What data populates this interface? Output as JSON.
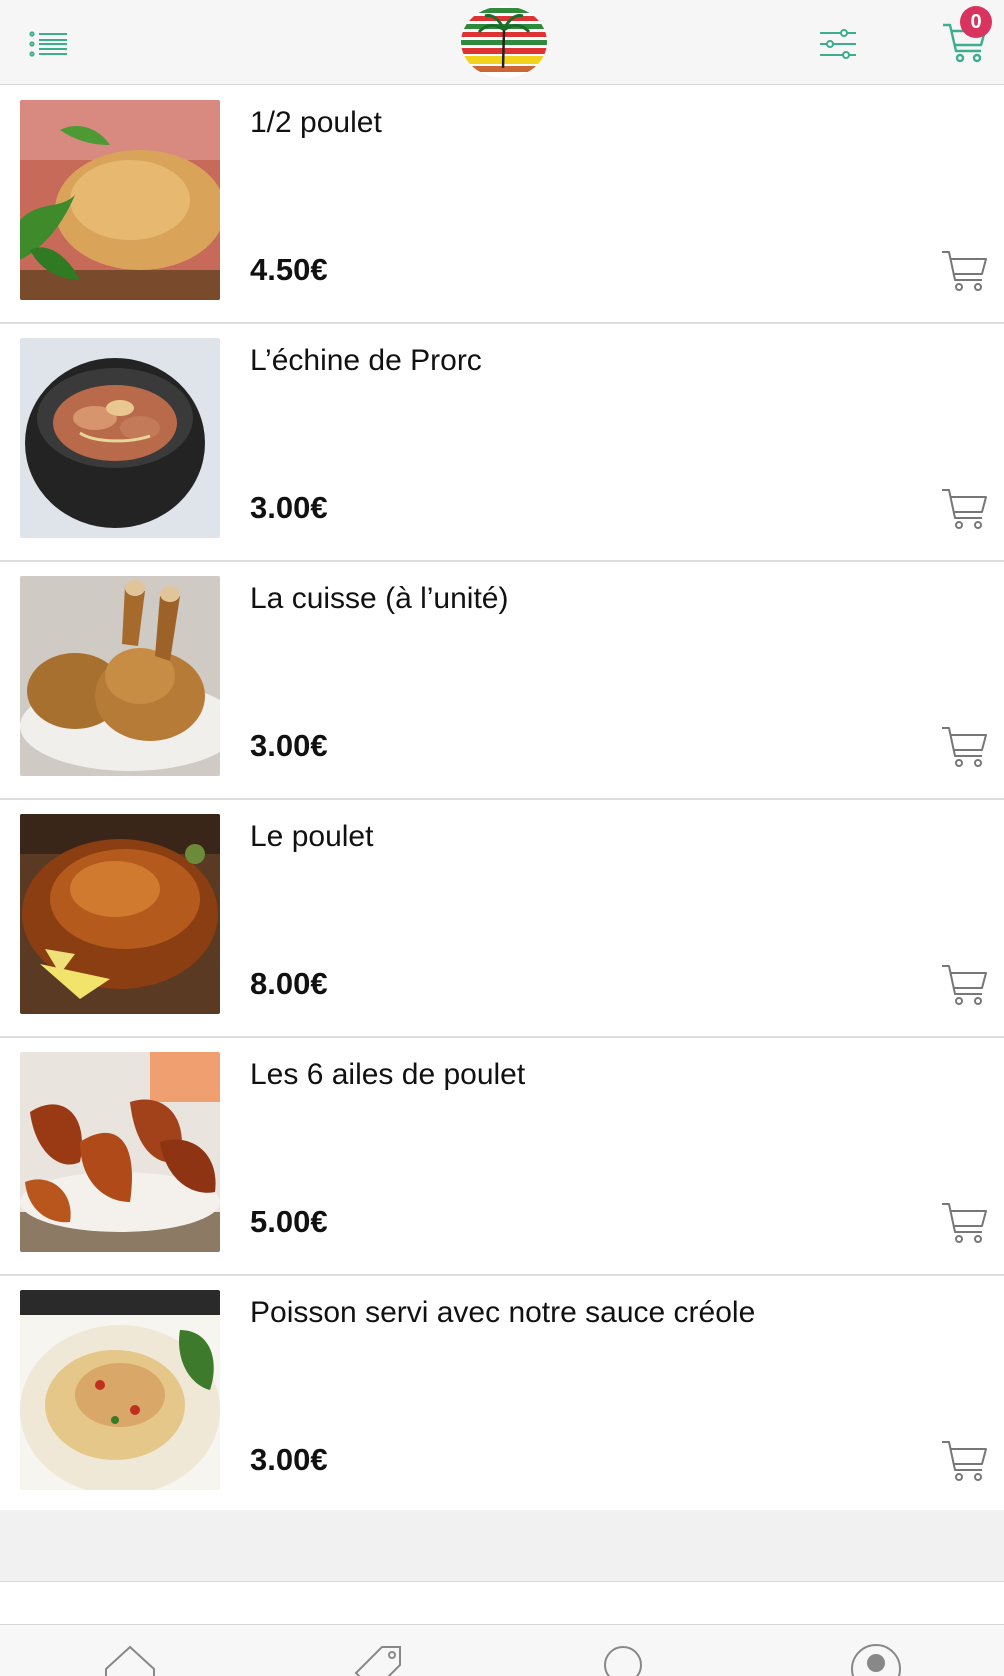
{
  "header": {
    "menu_icon": "list-menu-icon",
    "logo": "restaurant-logo-palm-tree",
    "filter_icon": "sliders-filter-icon",
    "cart_icon": "cart-icon",
    "cart_count": "0"
  },
  "colors": {
    "accent": "#3cae8e",
    "badge": "#d8345f",
    "header_bg": "#f6f6f6",
    "divider": "#dcdcdc"
  },
  "products": [
    {
      "name": "1/2 poulet",
      "price": "4.50€",
      "image": "half-roast-chicken"
    },
    {
      "name": "L’échine de Prorc",
      "price": "3.00€",
      "image": "pork-in-black-bowl"
    },
    {
      "name": "La cuisse (à l’unité)",
      "price": "3.00€",
      "image": "chicken-legs-plate"
    },
    {
      "name": "Le poulet",
      "price": "8.00€",
      "image": "whole-roast-chicken"
    },
    {
      "name": "Les 6 ailes de poulet",
      "price": "5.00€",
      "image": "chicken-wings"
    },
    {
      "name": "Poisson servi avec notre sauce créole",
      "price": "3.00€",
      "image": "fish-creole-sauce-rice"
    }
  ],
  "tabbar": {
    "tabs": [
      "home-icon",
      "tag-icon",
      "search-icon",
      "account-icon"
    ]
  }
}
